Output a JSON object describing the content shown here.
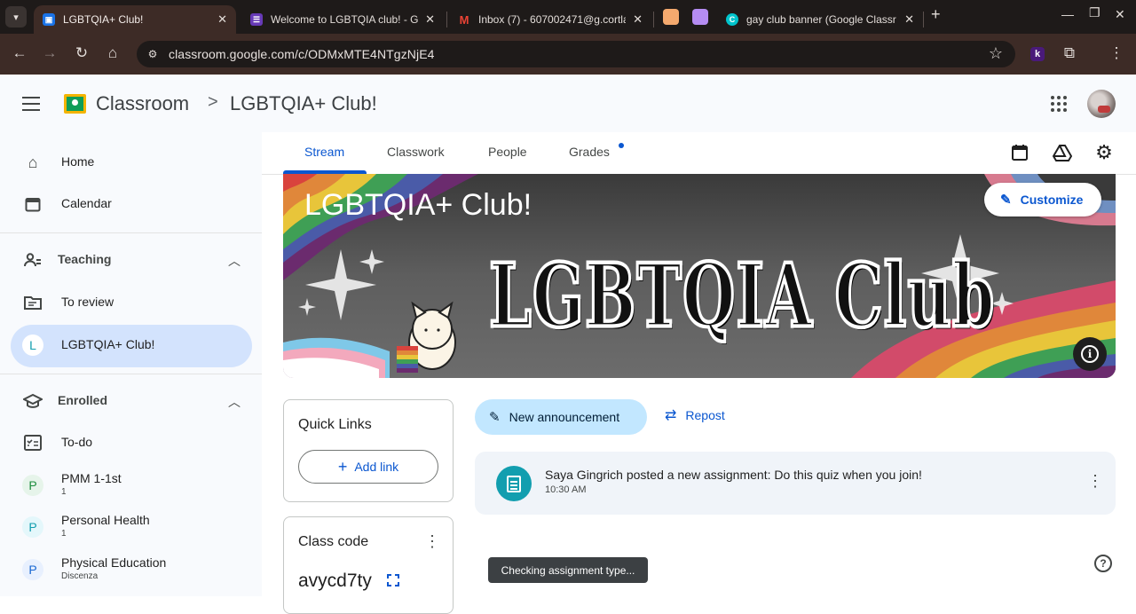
{
  "browser": {
    "tabs": [
      {
        "title": "LGBTQIA+ Club!",
        "favicon": "classroom-icon",
        "active": true
      },
      {
        "title": "Welcome to LGBTQIA club! - Go",
        "favicon": "forms-icon",
        "active": false
      },
      {
        "title": "Inbox (7) - 607002471@g.cortla",
        "favicon": "gmail-icon",
        "active": false
      },
      {
        "title": "gay club banner (Google Classr",
        "favicon": "canva-icon",
        "active": false
      }
    ],
    "url": "classroom.google.com/c/ODMxMTE4NTgzNjE4",
    "extension_letter": "k",
    "colors": {
      "frame": "#1e1a19",
      "toolbar": "#3d2b26"
    }
  },
  "header": {
    "app_name": "Classroom",
    "breadcrumb_separator": ">",
    "class_name": "LGBTQIA+ Club!"
  },
  "sidebar": {
    "home": "Home",
    "calendar": "Calendar",
    "teaching": "Teaching",
    "to_review": "To review",
    "active_class": {
      "letter": "L",
      "name": "LGBTQIA+ Club!"
    },
    "enrolled": "Enrolled",
    "todo": "To-do",
    "classes": [
      {
        "letter": "P",
        "name": "PMM 1-1st",
        "sub": "1",
        "color": "#1e8e3e"
      },
      {
        "letter": "P",
        "name": "Personal Health",
        "sub": "1",
        "color": "#129eaf"
      },
      {
        "letter": "P",
        "name": "Physical Education",
        "sub": "Discenza",
        "color": "#1967d2"
      }
    ]
  },
  "class_tabs": {
    "stream": "Stream",
    "classwork": "Classwork",
    "people": "People",
    "grades": "Grades"
  },
  "banner": {
    "title": "LGBTQIA+ Club!",
    "image_text": "LGBTQIA Club",
    "customize": "Customize"
  },
  "quick_links": {
    "title": "Quick Links",
    "add_link": "Add link"
  },
  "class_code": {
    "title": "Class code",
    "code": "avycd7ty"
  },
  "stream": {
    "new_announcement": "New announcement",
    "repost": "Repost",
    "posts": [
      {
        "text": "Saya Gingrich posted a new assignment: Do this quiz when you join!",
        "time": "10:30 AM"
      }
    ]
  },
  "toast": "Checking assignment type..."
}
